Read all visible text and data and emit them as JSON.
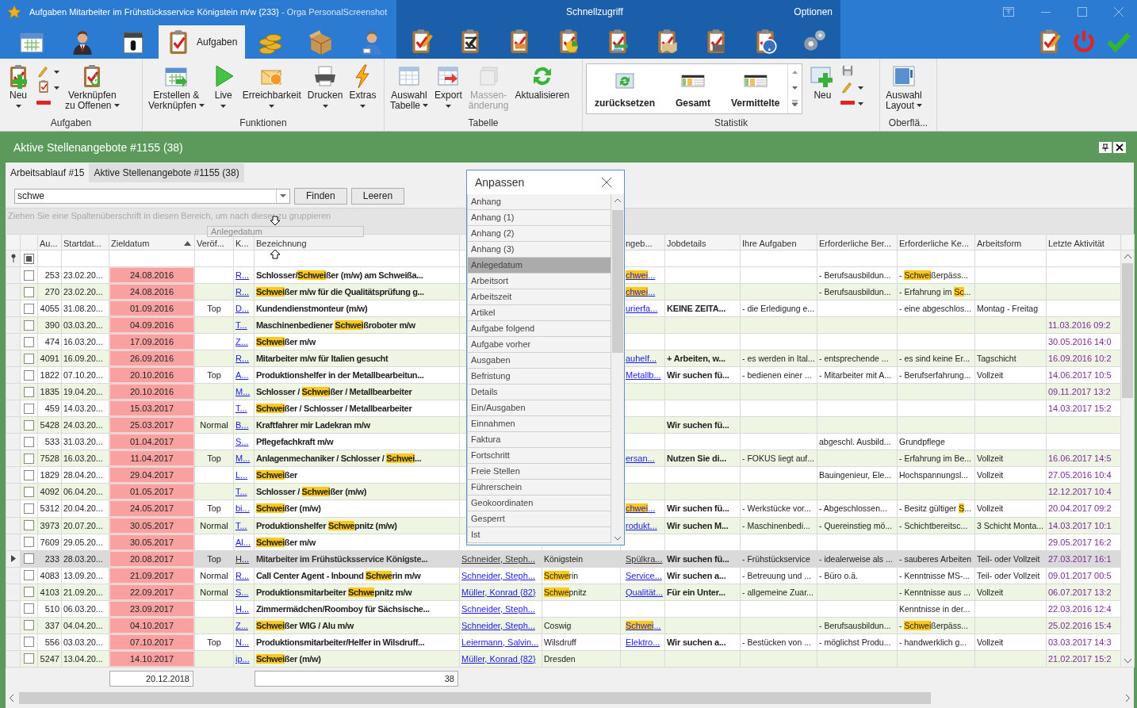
{
  "window": {
    "title": "Aufgaben Mitarbeiter im Frühstücksservice Königstein m/w {233}",
    "subtitle": "- Orga PersonalScreenshot"
  },
  "quick_access": {
    "label": "Schnellzugriff",
    "options": "Optionen"
  },
  "nav_tabs": [
    {
      "selected": false
    },
    {
      "selected": false
    },
    {
      "selected": false
    },
    {
      "label": "Aufgaben",
      "selected": true
    },
    {
      "selected": false
    },
    {
      "selected": false
    },
    {
      "selected": false
    }
  ],
  "ribbon": {
    "groups": [
      {
        "label": "Aufgaben",
        "items": [
          {
            "kind": "large",
            "lines": [
              "Neu"
            ],
            "caret": true,
            "disabled": false
          },
          {
            "kind": "stack",
            "buttons": [
              {
                "caret": true
              },
              {
                "caret": true
              },
              {
                "caret": false
              }
            ]
          },
          {
            "kind": "large",
            "lines": [
              "Verknüpfen",
              "zu Offenen"
            ],
            "caret": true,
            "disabled": false
          }
        ]
      },
      {
        "label": "Funktionen",
        "items": [
          {
            "kind": "large",
            "lines": [
              "Erstellen &",
              "Verknüpfen"
            ],
            "caret": true,
            "disabled": false
          },
          {
            "kind": "large",
            "lines": [
              "Live"
            ],
            "caret": true,
            "disabled": false
          },
          {
            "kind": "large",
            "lines": [
              "Erreichbarkeit"
            ],
            "caret": true,
            "disabled": false
          },
          {
            "kind": "large",
            "lines": [
              "Drucken"
            ],
            "caret": true,
            "disabled": false
          },
          {
            "kind": "large",
            "lines": [
              "Extras"
            ],
            "caret": true,
            "disabled": false
          }
        ]
      },
      {
        "label": "Tabelle",
        "items": [
          {
            "kind": "large",
            "lines": [
              "Auswahl",
              "Tabelle"
            ],
            "caret": true,
            "disabled": false
          },
          {
            "kind": "large",
            "lines": [
              "Export"
            ],
            "caret": true,
            "disabled": false
          },
          {
            "kind": "large",
            "lines": [
              "Massen-",
              "änderung"
            ],
            "caret": false,
            "disabled": true
          },
          {
            "kind": "large",
            "lines": [
              "Aktualisieren"
            ],
            "caret": false,
            "disabled": false
          }
        ]
      },
      {
        "label": "Statistik",
        "items": [
          {
            "kind": "gallery",
            "tiles": [
              {
                "label": "zurücksetzen"
              },
              {
                "label": "Gesamt"
              },
              {
                "label": "Vermittelte"
              }
            ]
          },
          {
            "kind": "large",
            "lines": [
              "Neu"
            ],
            "caret": false,
            "disabled": false
          },
          {
            "kind": "stack",
            "buttons": [
              {
                "caret": false
              },
              {
                "caret": true
              },
              {
                "caret": true
              }
            ]
          }
        ]
      },
      {
        "label": "Oberflä...",
        "items": [
          {
            "kind": "large",
            "lines": [
              "Auswahl",
              "Layout"
            ],
            "caret": true,
            "disabled": false
          }
        ]
      }
    ]
  },
  "panel": {
    "title": "Aktive Stellenangebote #1155 (38)",
    "tabs": [
      {
        "label": "Arbeitsablauf #15",
        "selected": false
      },
      {
        "label": "Aktive Stellenangebote #1155 (38)",
        "selected": true
      }
    ],
    "search": {
      "value": "schwe"
    },
    "buttons": [
      "Finden",
      "Leeren"
    ],
    "group_hint": "Ziehen Sie eine Spaltenüberschrift in diesen Bereich, um nach dieser zu gruppieren",
    "drag_column": "Anlegedatum"
  },
  "grid": {
    "columns": [
      {
        "label": "Au...",
        "kind": "num",
        "sorted": false
      },
      {
        "label": "Startdat...",
        "kind": "text",
        "sorted": false
      },
      {
        "label": "Zieldatum",
        "kind": "alert",
        "sorted": true,
        "summary": "20.12.2018"
      },
      {
        "label": "Veröf...",
        "kind": "center",
        "sorted": false
      },
      {
        "label": "K...",
        "kind": "link",
        "sorted": false
      },
      {
        "label": "Bezeichnung",
        "kind": "title",
        "sorted": false,
        "summary": "38"
      },
      {
        "kind": "link"
      },
      {
        "kind": "text"
      },
      {
        "label": "ngeb...",
        "kind": "link",
        "sorted": false
      },
      {
        "label": "Jobdetails",
        "kind": "bold",
        "sorted": false
      },
      {
        "label": "Ihre Aufgaben",
        "kind": "text",
        "sorted": false
      },
      {
        "label": "Erforderliche Ber...",
        "kind": "text",
        "sorted": false
      },
      {
        "label": "Erforderliche Ke...",
        "kind": "text",
        "sorted": false
      },
      {
        "label": "Arbeitsform",
        "kind": "text",
        "sorted": false
      },
      {
        "label": "Letzte Aktivität",
        "kind": "activity",
        "sorted": false
      }
    ],
    "rows": [
      {
        "selected": false,
        "checked": false,
        "cells": [
          "253",
          "23.02.20...",
          "24.08.2016",
          null,
          "R...",
          [
            {
              "text": "Schlosser/",
              "highlight": false
            },
            {
              "text": "Schwei",
              "highlight": true
            },
            {
              "text": "ßer (m/w) am Schweißa...",
              "highlight": false
            }
          ],
          null,
          null,
          [
            {
              "text": "chwei",
              "highlight": true
            },
            {
              "text": "...",
              "highlight": false
            }
          ],
          null,
          null,
          "- Berufsausbildun...",
          [
            {
              "text": "- ",
              "highlight": false
            },
            {
              "text": "Schwei",
              "highlight": true
            },
            {
              "text": "ßerpäss...",
              "highlight": false
            }
          ],
          null,
          null
        ]
      },
      {
        "selected": false,
        "checked": false,
        "cells": [
          "270",
          "23.02.20...",
          "24.08.2016",
          null,
          "R...",
          [
            {
              "text": "Schwei",
              "highlight": true
            },
            {
              "text": "ßer m/w für die Qualitätsprüfung g...",
              "highlight": false
            }
          ],
          null,
          null,
          [
            {
              "text": "chwei",
              "highlight": true
            },
            {
              "text": "...",
              "highlight": false
            }
          ],
          null,
          null,
          "- Berufsausbildun...",
          [
            {
              "text": "- Erfahrung im ",
              "highlight": false
            },
            {
              "text": "Sc",
              "highlight": true
            },
            {
              "text": "...",
              "highlight": false
            }
          ],
          null,
          null
        ]
      },
      {
        "selected": false,
        "checked": false,
        "cells": [
          "4055",
          "31.08.20...",
          "01.09.2016",
          "Top",
          "D...",
          "Kundendienstmonteur (m/w)",
          null,
          null,
          "urierfa...",
          "KEINE ZEITA...",
          "- die Erledigung e...",
          null,
          "- eine abgeschlos...",
          "Montag - Freitag",
          null
        ]
      },
      {
        "selected": false,
        "checked": false,
        "cells": [
          "390",
          "03.03.20...",
          "04.09.2016",
          null,
          "T...",
          [
            {
              "text": "Maschinenbediener ",
              "highlight": false
            },
            {
              "text": "Schwei",
              "highlight": true
            },
            {
              "text": "ßroboter m/w",
              "highlight": false
            }
          ],
          null,
          null,
          null,
          null,
          null,
          null,
          null,
          null,
          "11.03.2016 09:2"
        ]
      },
      {
        "selected": false,
        "checked": false,
        "cells": [
          "474",
          "16.03.20...",
          "17.09.2016",
          null,
          "Z...",
          [
            {
              "text": "Schwei",
              "highlight": true
            },
            {
              "text": "ßer m/w",
              "highlight": false
            }
          ],
          null,
          null,
          null,
          null,
          null,
          null,
          null,
          null,
          "30.05.2016 14:0"
        ]
      },
      {
        "selected": false,
        "checked": false,
        "cells": [
          "4091",
          "16.09.20...",
          "26.09.2016",
          null,
          "R...",
          "Mitarbeiter m/w für Italien gesucht",
          null,
          null,
          "auhelf...",
          "+ Arbeiten, w...",
          "- es werden in Ital...",
          "- entsprechende ...",
          "- es sind keine Er...",
          "Tagschicht",
          "16.09.2016 10:2"
        ]
      },
      {
        "selected": false,
        "checked": false,
        "cells": [
          "1822",
          "07.10.20...",
          "20.10.2016",
          "Top",
          "A...",
          "Produktionshelfer in der Metallbearbeitun...",
          null,
          null,
          "Metallb...",
          "Wir suchen fü...",
          "- bedienen einer ...",
          "- Mitarbeiter mit A...",
          "- Berufserfahrung...",
          "Vollzeit",
          "14.06.2017 10:5"
        ]
      },
      {
        "selected": false,
        "checked": false,
        "cells": [
          "1835",
          "19.04.20...",
          "20.10.2016",
          null,
          "M...",
          [
            {
              "text": "Schlosser / ",
              "highlight": false
            },
            {
              "text": "Schwei",
              "highlight": true
            },
            {
              "text": "ßer / Metallbearbeiter",
              "highlight": false
            }
          ],
          null,
          null,
          null,
          null,
          null,
          null,
          null,
          null,
          "09.11.2017 13:2"
        ]
      },
      {
        "selected": false,
        "checked": false,
        "cells": [
          "459",
          "14.03.20...",
          "15.03.2017",
          null,
          "T...",
          [
            {
              "text": "Schwei",
              "highlight": true
            },
            {
              "text": "ßer / Schlosser / Metallbearbeiter",
              "highlight": false
            }
          ],
          null,
          null,
          null,
          null,
          null,
          null,
          null,
          null,
          "14.03.2017 15:2"
        ]
      },
      {
        "selected": false,
        "checked": false,
        "cells": [
          "5428",
          "24.03.20...",
          "25.03.2017",
          "Normal",
          "B...",
          "Kraftfahrer mir Ladekran m/w",
          null,
          null,
          null,
          "Wir suchen fü...",
          null,
          null,
          null,
          null,
          null
        ]
      },
      {
        "selected": false,
        "checked": false,
        "cells": [
          "533",
          "31.03.20...",
          "01.04.2017",
          null,
          "S...",
          "Pflegefachkraft m/w",
          null,
          null,
          null,
          null,
          null,
          "abgeschl. Ausbild...",
          "Grundpflege",
          null,
          null
        ]
      },
      {
        "selected": false,
        "checked": false,
        "cells": [
          "7528",
          "16.03.20...",
          "11.04.2017",
          "Top",
          "M...",
          [
            {
              "text": "Anlagenmechaniker / Schlosser / ",
              "highlight": false
            },
            {
              "text": "Schwei",
              "highlight": true
            },
            {
              "text": "...",
              "highlight": false
            }
          ],
          null,
          null,
          "ersan...",
          "Nutzen Sie di...",
          "- FOKUS liegt auf...",
          null,
          "- Erfahrung im Be...",
          "Vollzeit",
          "16.06.2017 14:5"
        ]
      },
      {
        "selected": false,
        "checked": false,
        "cells": [
          "1829",
          "28.04.20...",
          "29.04.2017",
          null,
          "L...",
          [
            {
              "text": "Schwei",
              "highlight": true
            },
            {
              "text": "ßer",
              "highlight": false
            }
          ],
          null,
          null,
          null,
          null,
          null,
          "Bauingenieur, Ele...",
          "Hochspannungsl...",
          "Vollzeit",
          "27.05.2016 10:4"
        ]
      },
      {
        "selected": false,
        "checked": false,
        "cells": [
          "4092",
          "06.04.20...",
          "01.05.2017",
          null,
          "T...",
          [
            {
              "text": "Schlosser / ",
              "highlight": false
            },
            {
              "text": "Schwei",
              "highlight": true
            },
            {
              "text": "ßer (m/w)",
              "highlight": false
            }
          ],
          null,
          null,
          null,
          null,
          null,
          null,
          null,
          null,
          "12.12.2017 10:4"
        ]
      },
      {
        "selected": false,
        "checked": false,
        "cells": [
          "5312",
          "20.04.20...",
          "24.05.2017",
          "Top",
          "bi...",
          [
            {
              "text": "Schwei",
              "highlight": true
            },
            {
              "text": "ßer (m/w)",
              "highlight": false
            }
          ],
          null,
          null,
          [
            {
              "text": "chwei",
              "highlight": true
            },
            {
              "text": "...",
              "highlight": false
            }
          ],
          "Wir suchen fü...",
          "- Werkstücke vor...",
          "- Abgeschlossen...",
          [
            {
              "text": "- Besitz gültiger ",
              "highlight": false
            },
            {
              "text": "S",
              "highlight": true
            },
            {
              "text": "...",
              "highlight": false
            }
          ],
          "Vollzeit",
          "20.04.2017 09:2"
        ]
      },
      {
        "selected": false,
        "checked": false,
        "cells": [
          "3973",
          "20.07.20...",
          "30.05.2017",
          "Normal",
          "T...",
          [
            {
              "text": "Produktionshelfer ",
              "highlight": false
            },
            {
              "text": "Schwe",
              "highlight": true
            },
            {
              "text": "pnitz (m/w)",
              "highlight": false
            }
          ],
          null,
          null,
          "rodukt...",
          "Wir suchen M...",
          "- Maschinenbedi...",
          "- Quereinstieg mö...",
          "- Schichtbereitsc...",
          "3 Schicht Monta...",
          "14.03.2017 10:1"
        ]
      },
      {
        "selected": false,
        "checked": false,
        "cells": [
          "7609",
          "29.05.20...",
          "30.05.2017",
          null,
          "Al...",
          [
            {
              "text": "Schwei",
              "highlight": true
            },
            {
              "text": "ßer m/w",
              "highlight": false
            }
          ],
          null,
          null,
          null,
          null,
          null,
          null,
          null,
          null,
          "29.05.2017 16:2"
        ]
      },
      {
        "selected": true,
        "checked": false,
        "cells": [
          "233",
          "28.03.20...",
          "20.08.2017",
          "Top",
          "H...",
          "Mitarbeiter im Frühstücksservice Königste...",
          "Schneider, Steph...",
          "Königstein",
          "Spülkra...",
          "Wir suchen fü...",
          "- Frühstückservice",
          "- idealerweise als ...",
          "- sauberes Arbeiten",
          "Teil- oder Vollzeit",
          "27.03.2017 16:1"
        ]
      },
      {
        "selected": false,
        "checked": false,
        "cells": [
          "4083",
          "13.09.20...",
          "21.09.2017",
          "Normal",
          "R...",
          [
            {
              "text": "Call Center Agent - Inbound ",
              "highlight": false
            },
            {
              "text": "Schwe",
              "highlight": true
            },
            {
              "text": "rin m/w",
              "highlight": false
            }
          ],
          "Schneider, Steph...",
          [
            {
              "text": "Schwe",
              "highlight": true
            },
            {
              "text": "rin",
              "highlight": false
            }
          ],
          "Service...",
          "Wir suchen a...",
          "- Betreuung und ...",
          "- Büro o.ä.",
          "- Kenntnisse MS-...",
          "Teil- oder Vollzeit",
          "09.01.2017 00:5"
        ]
      },
      {
        "selected": false,
        "checked": false,
        "cells": [
          "4103",
          "21.09.20...",
          "22.09.2017",
          "Normal",
          "S...",
          [
            {
              "text": "Produktionsmitarbeiter ",
              "highlight": false
            },
            {
              "text": "Schwe",
              "highlight": true
            },
            {
              "text": "pnitz m/w",
              "highlight": false
            }
          ],
          "Müller, Konrad {82}",
          [
            {
              "text": "Schwe",
              "highlight": true
            },
            {
              "text": "pnitz",
              "highlight": false
            }
          ],
          "Qualität...",
          "Für ein Unter...",
          "- allgemeine Zuar...",
          null,
          "- Kenntnisse aus ...",
          "Vollzeit",
          "06.07.2017 13:2"
        ]
      },
      {
        "selected": false,
        "checked": false,
        "cells": [
          "510",
          "06.03.20...",
          "23.09.2017",
          null,
          "H...",
          "Zimmermädchen/Roomboy für Sächsische...",
          "Schneider, Steph...",
          null,
          null,
          null,
          null,
          null,
          "Kenntnisse in der...",
          null,
          "22.03.2016 12:4"
        ]
      },
      {
        "selected": false,
        "checked": false,
        "cells": [
          "337",
          "04.04.20...",
          "04.10.2017",
          null,
          "Z...",
          [
            {
              "text": "Schwei",
              "highlight": true
            },
            {
              "text": "ßer WIG / Alu m/w",
              "highlight": false
            }
          ],
          "Schneider, Steph...",
          "Coswig",
          [
            {
              "text": "Schwei",
              "highlight": true
            },
            {
              "text": "...",
              "highlight": false
            }
          ],
          null,
          null,
          "- Berufsausbildun...",
          [
            {
              "text": "- ",
              "highlight": false
            },
            {
              "text": "Schwei",
              "highlight": true
            },
            {
              "text": "ßerpäss...",
              "highlight": false
            }
          ],
          null,
          "25.02.2016 15:4"
        ]
      },
      {
        "selected": false,
        "checked": false,
        "cells": [
          "556",
          "03.03.20...",
          "07.10.2017",
          "Top",
          "N...",
          "Produktionsmitarbeiter/Helfer in Wilsdruff...",
          "Leiermann, Salvin...",
          "Wilsdruff",
          "Elektro...",
          "Wir suchen a...",
          "- Bestücken von ...",
          "- möglichst Produ...",
          "- handwerklich g...",
          "Vollzeit",
          "03.03.2017 14:3"
        ]
      },
      {
        "selected": false,
        "checked": false,
        "cells": [
          "5247",
          "13.04.20...",
          "14.10.2017",
          null,
          "ip...",
          [
            {
              "text": "Schwei",
              "highlight": true
            },
            {
              "text": "ßer (m/w)",
              "highlight": false
            }
          ],
          "Müller, Konrad {82}",
          "Dresden",
          null,
          null,
          null,
          null,
          null,
          null,
          "21.02.2017 15:2"
        ]
      }
    ],
    "select_all": {
      "indeterminate": true
    }
  },
  "customize": {
    "title": "Anpassen",
    "items": [
      {
        "label": "Anhang",
        "selected": false
      },
      {
        "label": "Anhang (1)",
        "selected": false
      },
      {
        "label": "Anhang (2)",
        "selected": false
      },
      {
        "label": "Anhang (3)",
        "selected": false
      },
      {
        "label": "Anlegedatum",
        "selected": true
      },
      {
        "label": "Arbeitsort",
        "selected": false
      },
      {
        "label": "Arbeitszeit",
        "selected": false
      },
      {
        "label": "Artikel",
        "selected": false
      },
      {
        "label": "Aufgabe folgend",
        "selected": false
      },
      {
        "label": "Aufgabe vorher",
        "selected": false
      },
      {
        "label": "Ausgaben",
        "selected": false
      },
      {
        "label": "Befristung",
        "selected": false
      },
      {
        "label": "Details",
        "selected": false
      },
      {
        "label": "Ein/Ausgaben",
        "selected": false
      },
      {
        "label": "Einnahmen",
        "selected": false
      },
      {
        "label": "Faktura",
        "selected": false
      },
      {
        "label": "Fortschritt",
        "selected": false
      },
      {
        "label": "Freie Stellen",
        "selected": false
      },
      {
        "label": "Führerschein",
        "selected": false
      },
      {
        "label": "Geokoordinaten",
        "selected": false
      },
      {
        "label": "Gesperrt",
        "selected": false
      },
      {
        "label": "Ist",
        "selected": false
      }
    ]
  }
}
